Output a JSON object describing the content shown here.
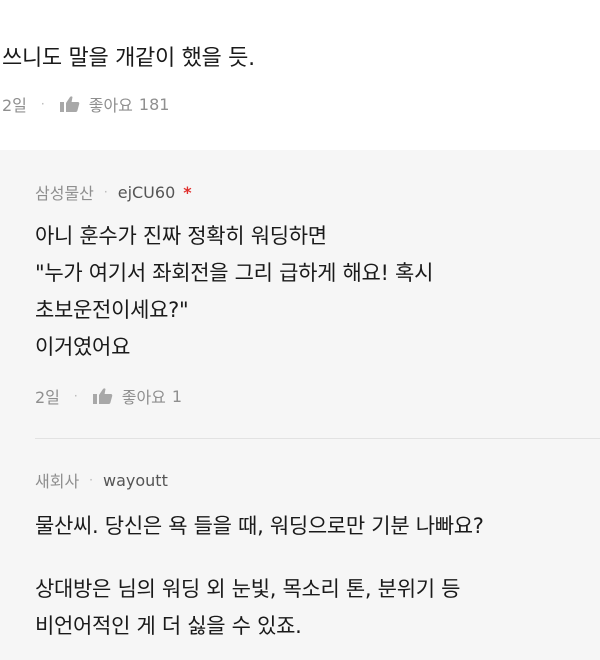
{
  "top_comment": {
    "text": "쓰니도 말을 개같이 했을 듯.",
    "time": "2일",
    "like_label": "좋아요",
    "like_count": "181"
  },
  "replies": [
    {
      "company": "삼성물산",
      "user": "ejCU60",
      "badge": "*",
      "lines": [
        "아니 훈수가 진짜 정확히 워딩하면",
        "\"누가 여기서 좌회전을 그리 급하게 해요! 혹시",
        "초보운전이세요?\"",
        "이거였어요"
      ],
      "time": "2일",
      "like_label": "좋아요",
      "like_count": "1"
    },
    {
      "company": "새회사",
      "user": "wayoutt",
      "lines": [
        "물산씨. 당신은 욕 들을 때, 워딩으로만 기분 나빠요?",
        "상대방은 님의 워딩 외 눈빛, 목소리 톤, 분위기 등",
        "비언어적인 게 더 싫을 수 있죠."
      ]
    }
  ],
  "separator": "·",
  "icons": {
    "like": "thumbs-up-icon"
  },
  "colors": {
    "meta": "#8f8f8f",
    "reply_bg": "#f6f6f6",
    "badge": "#e0302d"
  }
}
